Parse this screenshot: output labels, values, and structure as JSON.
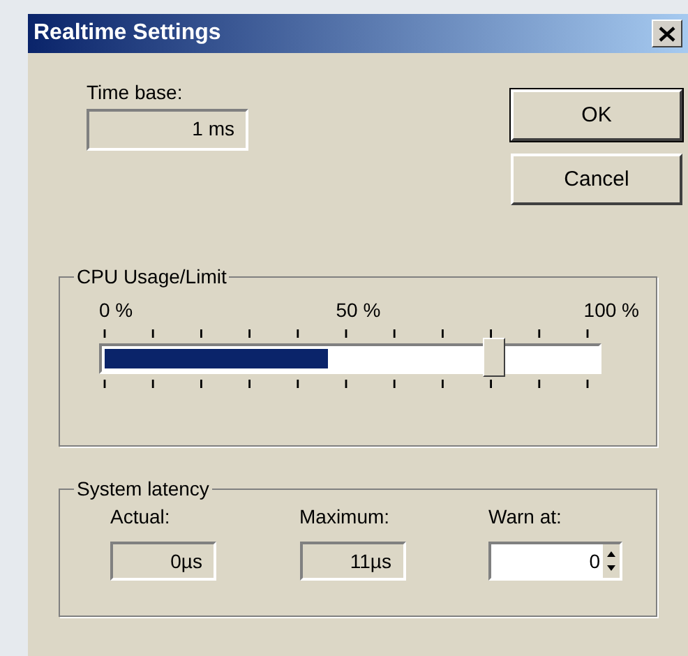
{
  "window": {
    "title": "Realtime Settings"
  },
  "time_base": {
    "label": "Time base:",
    "value": "1 ms"
  },
  "buttons": [
    {
      "label": "OK",
      "default": true
    },
    {
      "label": "Cancel",
      "default": false
    }
  ],
  "cpu": {
    "title": "CPU Usage/Limit",
    "scale": [
      "0 %",
      "50 %",
      "100 %"
    ],
    "usage": {
      "level": 0.45
    },
    "limit": {
      "level": 0.79
    }
  },
  "latency": {
    "title": "System latency",
    "fields": [
      {
        "kind": "readout",
        "label": "Actual:",
        "value": "0µs"
      },
      {
        "kind": "readout",
        "label": "Maximum:",
        "value": "11µs"
      },
      {
        "kind": "spinner",
        "label": "Warn at:",
        "value": "0"
      }
    ]
  }
}
